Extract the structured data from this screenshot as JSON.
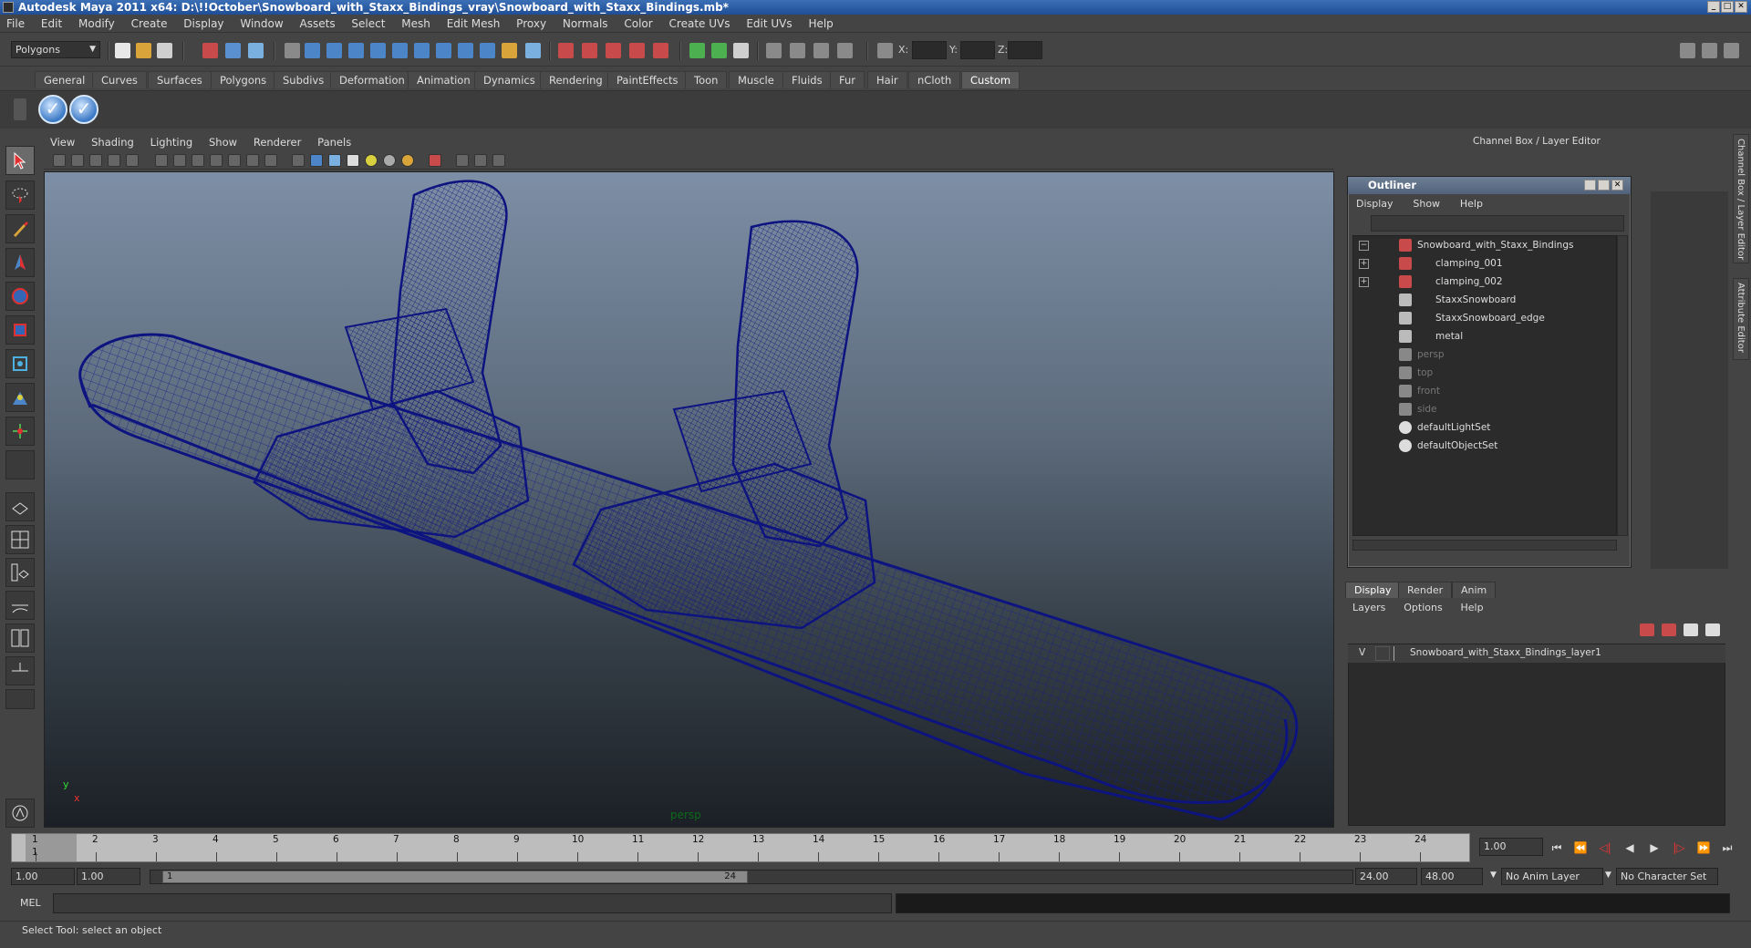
{
  "window": {
    "title": "Autodesk Maya 2011 x64: D:\\!!October\\Snowboard_with_Staxx_Bindings_vray\\Snowboard_with_Staxx_Bindings.mb*",
    "min": "_",
    "max": "□",
    "close": "✕"
  },
  "menubar": [
    "File",
    "Edit",
    "Modify",
    "Create",
    "Display",
    "Window",
    "Assets",
    "Select",
    "Mesh",
    "Edit Mesh",
    "Proxy",
    "Normals",
    "Color",
    "Create UVs",
    "Edit UVs",
    "Help"
  ],
  "statusline": {
    "mode": "Polygons",
    "x_label": "X:",
    "y_label": "Y:",
    "z_label": "Z:"
  },
  "shelf_tabs": [
    "General",
    "Curves",
    "Surfaces",
    "Polygons",
    "Subdivs",
    "Deformation",
    "Animation",
    "Dynamics",
    "Rendering",
    "PaintEffects",
    "Toon",
    "Muscle",
    "Fluids",
    "Fur",
    "Hair",
    "nCloth",
    "Custom"
  ],
  "shelf_active": "Custom",
  "viewport": {
    "menu": [
      "View",
      "Shading",
      "Lighting",
      "Show",
      "Renderer",
      "Panels"
    ],
    "camera": "persp",
    "axis_x": "x",
    "axis_y": "y"
  },
  "channel_box": {
    "title": "Channel Box / Layer Editor"
  },
  "outliner": {
    "title": "Outliner",
    "menu": [
      "Display",
      "Show",
      "Help"
    ],
    "items": [
      {
        "label": "Snowboard_with_Staxx_Bindings",
        "expander": "−",
        "dim": false
      },
      {
        "label": "clamping_001",
        "expander": "+",
        "dim": false
      },
      {
        "label": "clamping_002",
        "expander": "+",
        "dim": false
      },
      {
        "label": "StaxxSnowboard",
        "expander": "",
        "dim": false
      },
      {
        "label": "StaxxSnowboard_edge",
        "expander": "",
        "dim": false
      },
      {
        "label": "metal",
        "expander": "",
        "dim": false
      },
      {
        "label": "persp",
        "expander": "",
        "dim": true
      },
      {
        "label": "top",
        "expander": "",
        "dim": true
      },
      {
        "label": "front",
        "expander": "",
        "dim": true
      },
      {
        "label": "side",
        "expander": "",
        "dim": true
      },
      {
        "label": "defaultLightSet",
        "expander": "",
        "dim": false
      },
      {
        "label": "defaultObjectSet",
        "expander": "",
        "dim": false
      }
    ]
  },
  "layer_editor": {
    "tabs": [
      "Display",
      "Render",
      "Anim"
    ],
    "menu": [
      "Layers",
      "Options",
      "Help"
    ],
    "layer": {
      "visible": "V",
      "name": "Snowboard_with_Staxx_Bindings_layer1"
    }
  },
  "time_slider": {
    "ticks": [
      "1",
      "2",
      "3",
      "4",
      "5",
      "6",
      "7",
      "8",
      "9",
      "10",
      "11",
      "12",
      "13",
      "14",
      "15",
      "16",
      "17",
      "18",
      "19",
      "20",
      "21",
      "22",
      "23",
      "24"
    ],
    "current_marker": "1",
    "current_frame": "1.00"
  },
  "range": {
    "start": "1.00",
    "playback_start": "1.00",
    "handle_start": "1",
    "handle_end": "24",
    "playback_end": "24.00",
    "end": "48.00",
    "anim_layer": "No Anim Layer",
    "character_set": "No Character Set"
  },
  "cmd": {
    "label": "MEL"
  },
  "help_line": "Select Tool: select an object",
  "side_tabs": [
    "Channel Box / Layer Editor",
    "Attribute Editor"
  ]
}
